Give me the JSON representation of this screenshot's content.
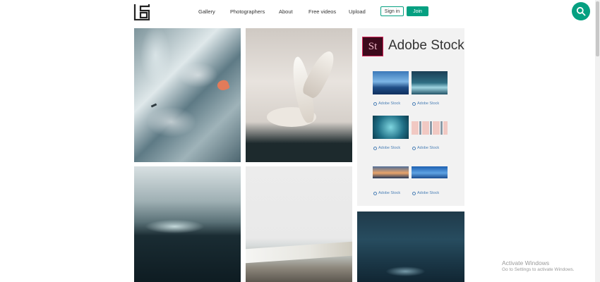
{
  "header": {
    "nav": [
      "Gallery",
      "Photographers",
      "About",
      "Free videos",
      "Upload"
    ],
    "signin_label": "Sign in",
    "join_label": "Join",
    "accent_color": "#05a081"
  },
  "ad": {
    "logo_text": "St",
    "title": "Adobe Stock",
    "link_label": "Adobe Stock",
    "brand_colors": {
      "logo_bg": "#3d0a1c",
      "logo_border": "#d6255a"
    }
  },
  "watermark": {
    "title": "Activate Windows",
    "subtitle": "Go to Settings to activate Windows."
  }
}
